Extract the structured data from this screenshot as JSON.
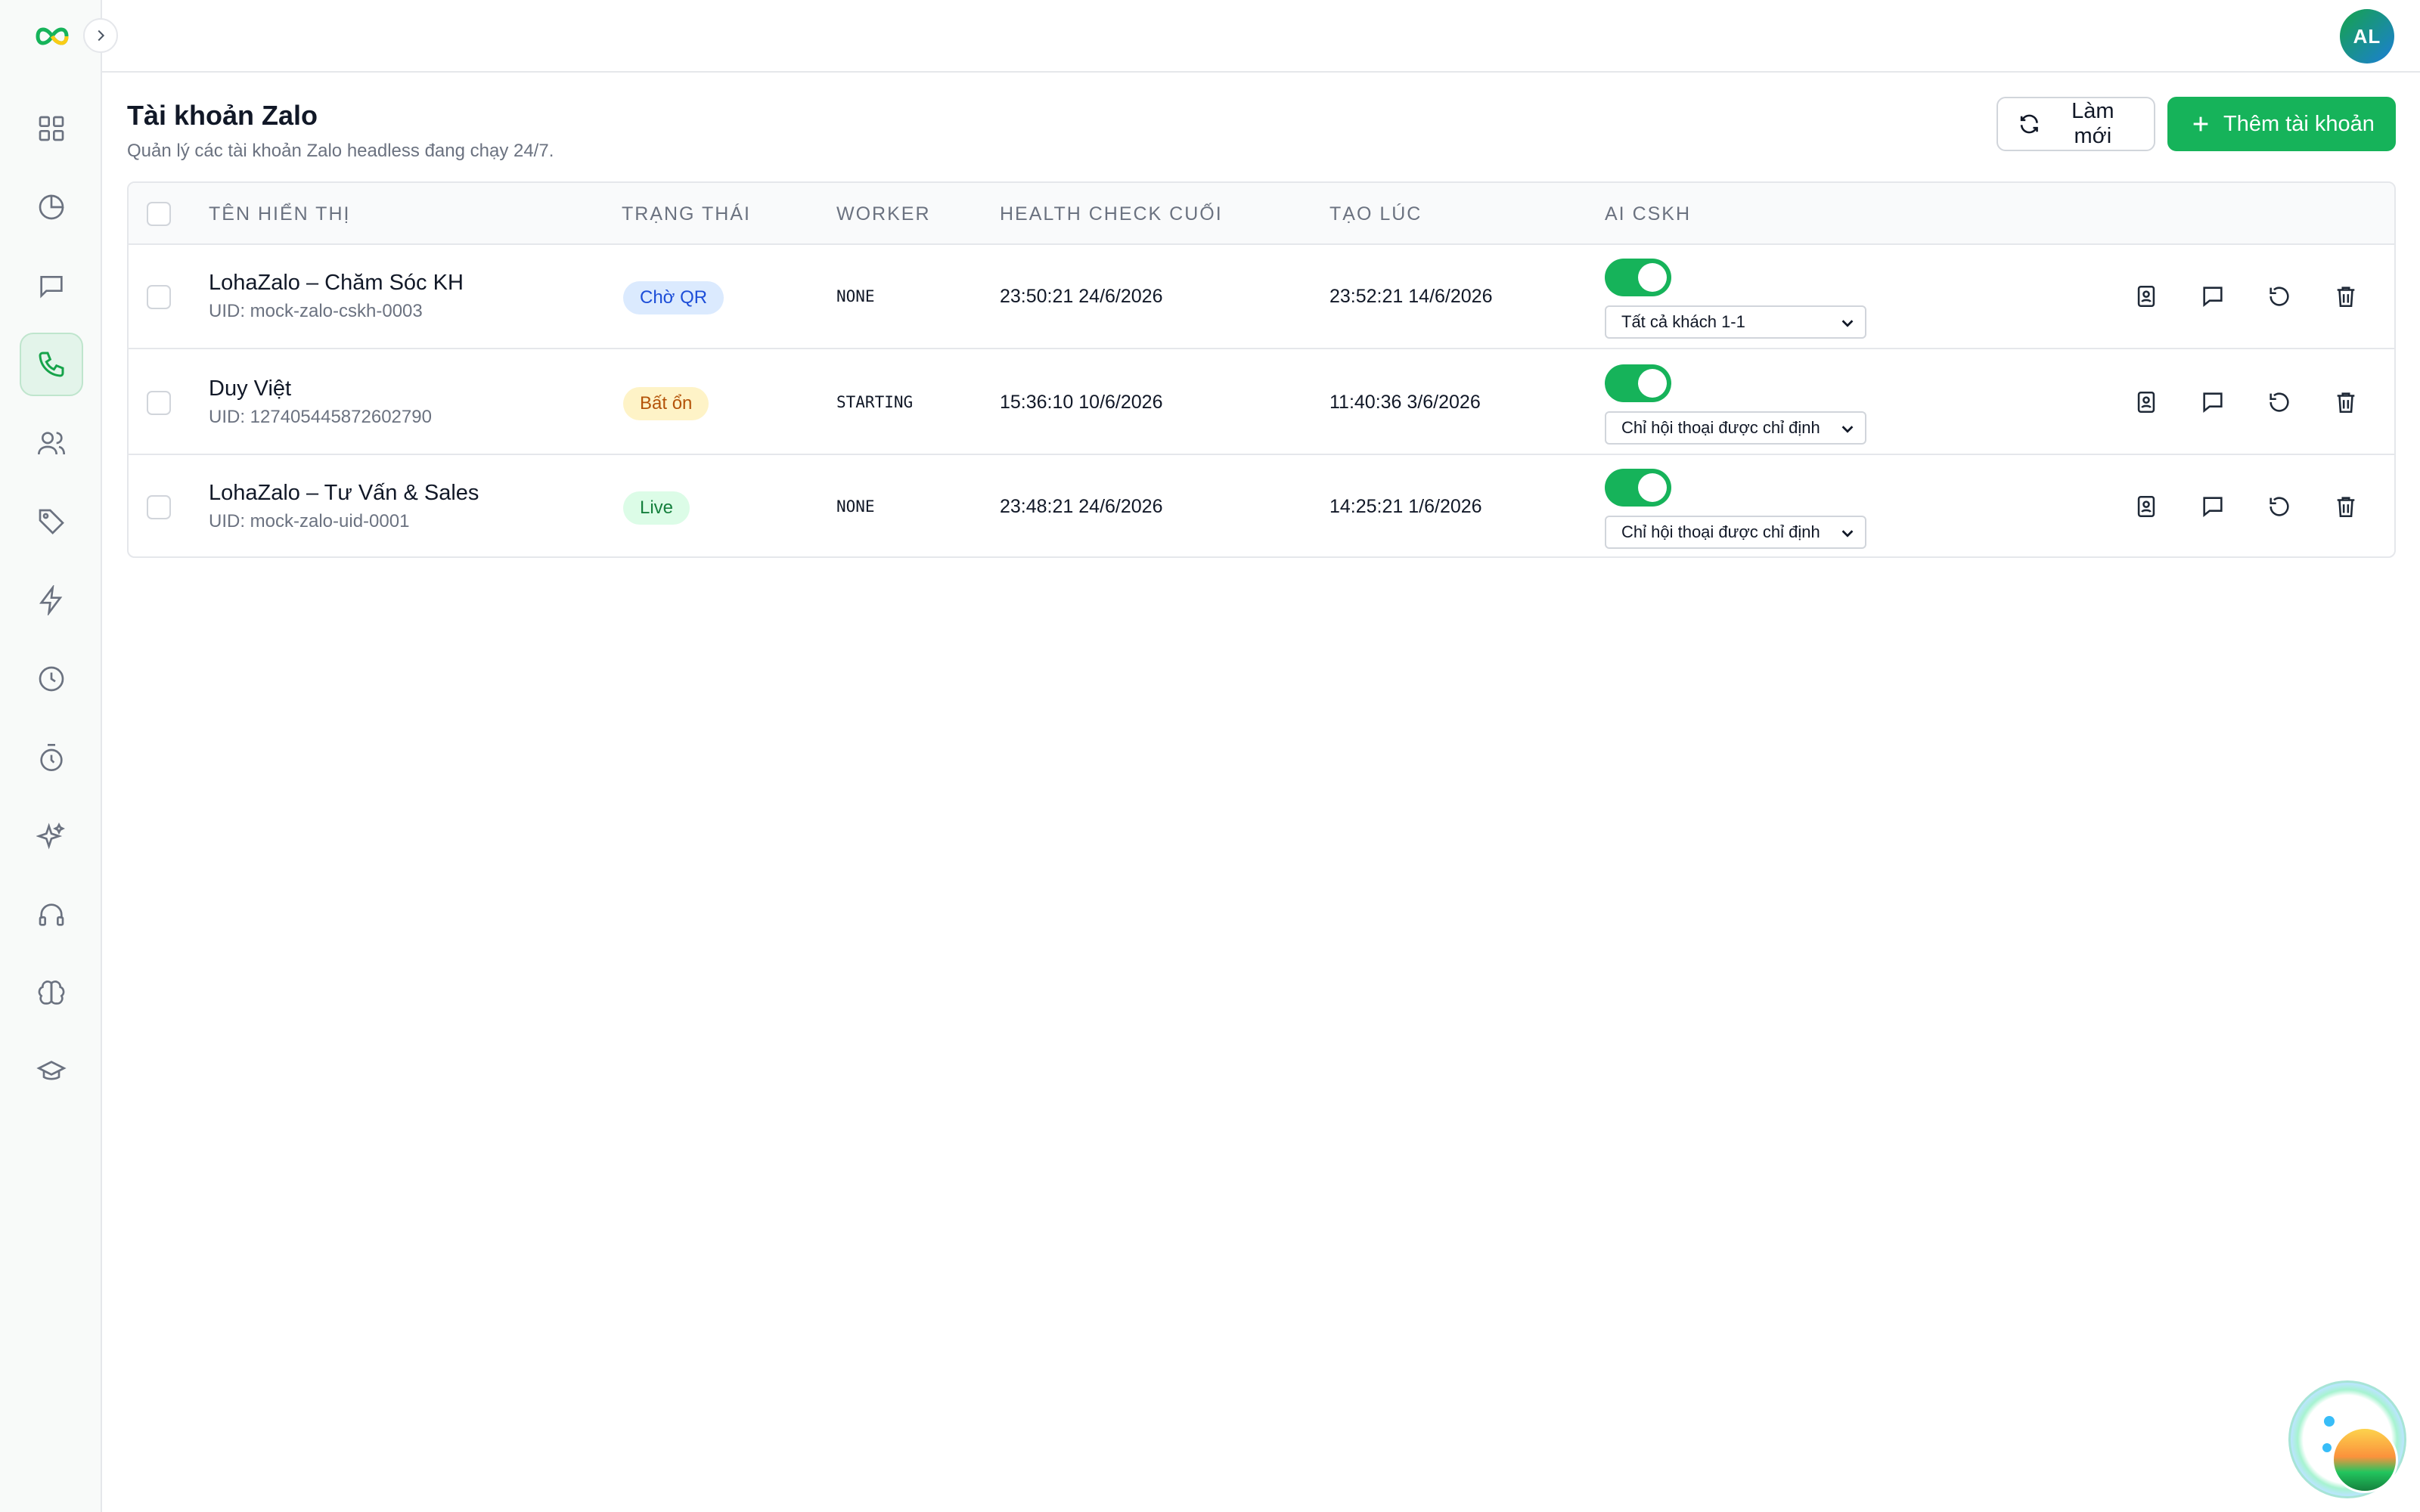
{
  "user": {
    "initials": "AL"
  },
  "page": {
    "title": "Tài khoản Zalo",
    "subtitle": "Quản lý các tài khoản Zalo headless đang chạy 24/7."
  },
  "actions": {
    "refresh_label": "Làm mới",
    "add_label": "Thêm tài khoản"
  },
  "sidebar": {
    "items": [
      {
        "icon": "dashboard-icon"
      },
      {
        "icon": "pie-chart-icon"
      },
      {
        "icon": "chat-icon"
      },
      {
        "icon": "phone-icon",
        "active": true
      },
      {
        "icon": "users-icon"
      },
      {
        "icon": "tag-icon"
      },
      {
        "icon": "lightning-icon"
      },
      {
        "icon": "clock-icon"
      },
      {
        "icon": "timer-icon"
      },
      {
        "icon": "sparkles-icon"
      },
      {
        "icon": "headphones-icon"
      },
      {
        "icon": "brain-icon"
      },
      {
        "icon": "graduation-cap-icon"
      }
    ]
  },
  "table": {
    "headers": {
      "name": "TÊN HIỂN THỊ",
      "status": "TRẠNG THÁI",
      "worker": "WORKER",
      "health": "HEALTH CHECK CUỐI",
      "created": "TẠO LÚC",
      "ai": "AI CSKH"
    },
    "rows": [
      {
        "name": "LohaZalo – Chăm Sóc KH",
        "uid": "UID: mock-zalo-cskh-0003",
        "status": "Chờ QR",
        "worker": "NONE",
        "health": "23:50:21 24/6/2026",
        "created": "23:52:21 14/6/2026",
        "ai_enabled": true,
        "ai_scope": "Tất cả khách 1-1"
      },
      {
        "name": "Duy Việt",
        "uid": "UID: 127405445872602790",
        "status": "Bất ổn",
        "worker": "STARTING",
        "health": "15:36:10 10/6/2026",
        "created": "11:40:36 3/6/2026",
        "ai_enabled": true,
        "ai_scope": "Chỉ hội thoại được chỉ định"
      },
      {
        "name": "LohaZalo – Tư Vấn & Sales",
        "uid": "UID: mock-zalo-uid-0001",
        "status": "Live",
        "worker": "NONE",
        "health": "23:48:21 24/6/2026",
        "created": "14:25:21 1/6/2026",
        "ai_enabled": true,
        "ai_scope": "Chỉ hội thoại được chỉ định"
      }
    ]
  },
  "colors": {
    "brand": "#16b35a",
    "status_qr": "#1d4ed8",
    "status_unstable": "#b45309",
    "status_live": "#15803d"
  }
}
